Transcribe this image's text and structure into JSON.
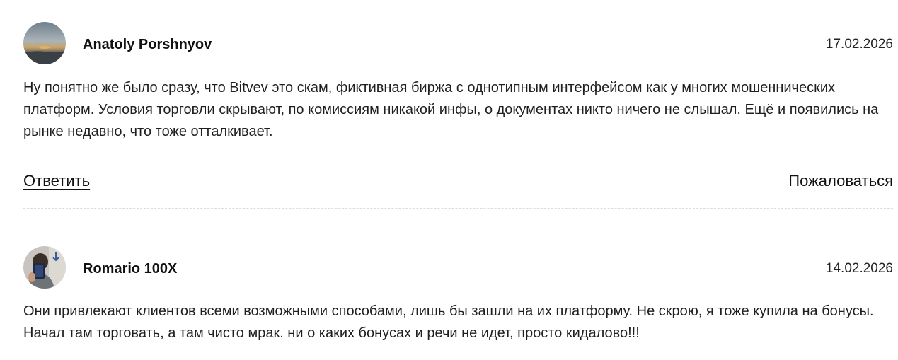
{
  "comments": [
    {
      "author": "Anatoly Porshnyov",
      "date": "17.02.2026",
      "text": "Ну понятно же было сразу, что Bitvev это скам, фиктивная биржа с однотипным интерфейсом как у многих мошеннических платформ. Условия торговли скрывают, по комиссиям никакой инфы, о документах никто ничего не слышал. Ещё и появились на рынке недавно, что тоже отталкивает.",
      "reply_label": "Ответить",
      "report_label": "Пожаловаться"
    },
    {
      "author": "Romario 100X",
      "date": "14.02.2026",
      "text": "Они привлекают клиентов всеми возможными способами, лишь бы зашли на их платформу. Не скрою, я тоже купила на бонусы. Начал там торговать, а там чисто мрак. ни о каких бонусах и речи не идет, просто кидалово!!!"
    }
  ]
}
